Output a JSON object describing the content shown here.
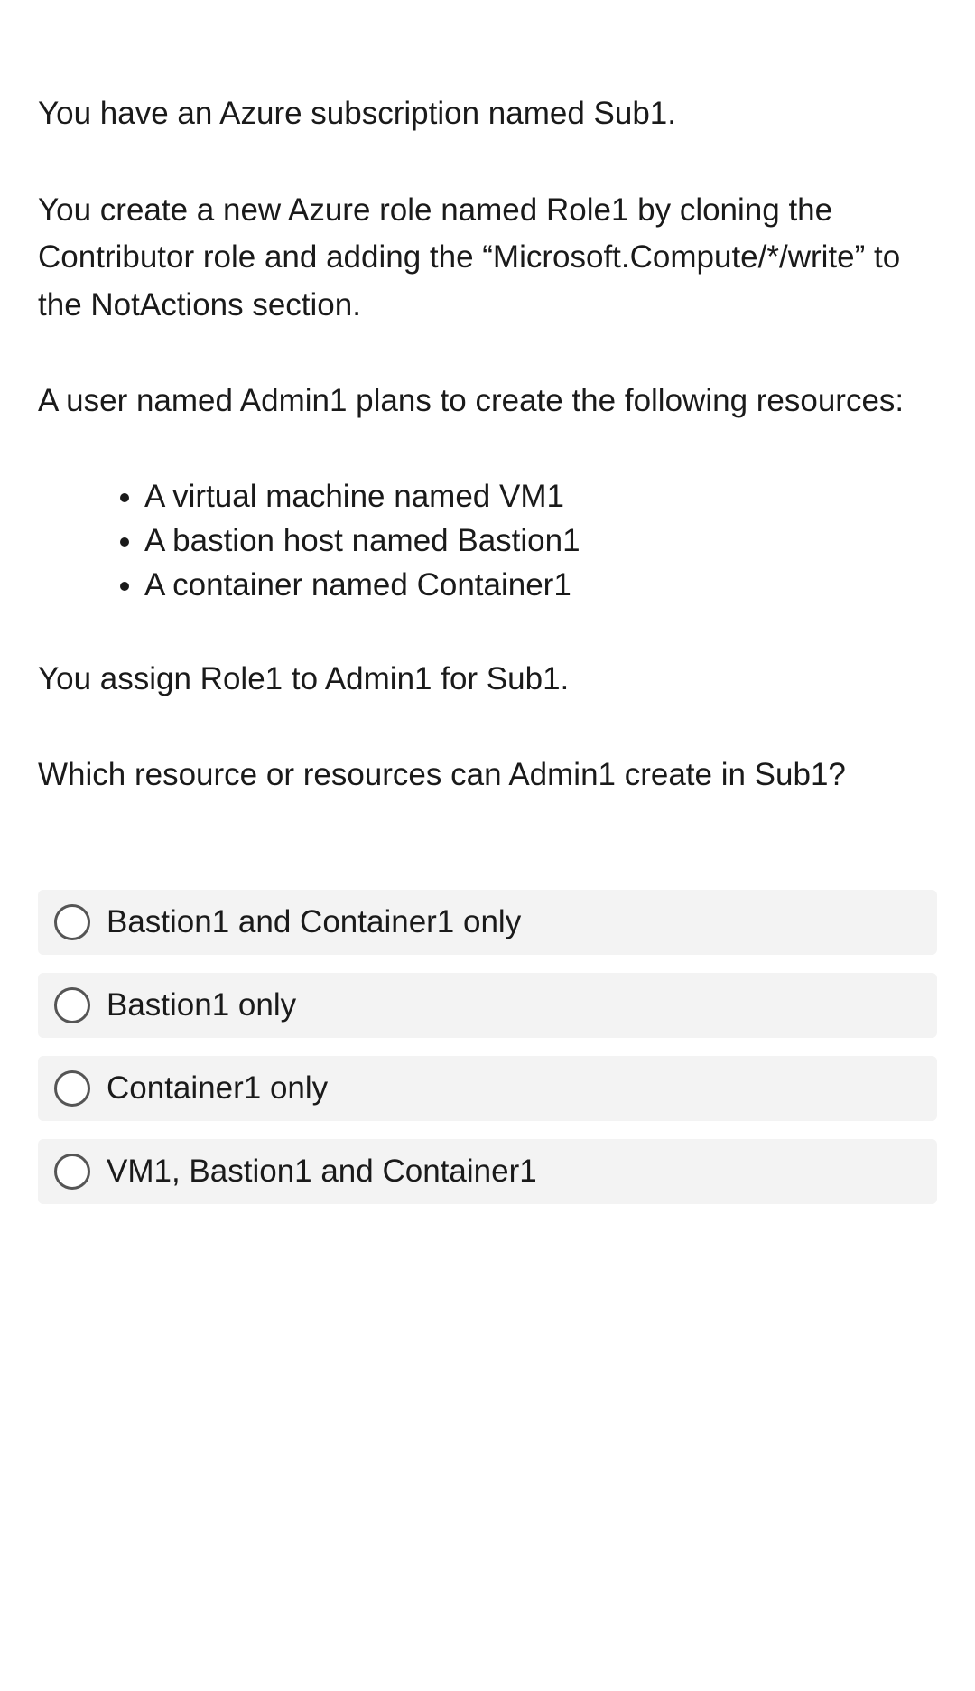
{
  "question": {
    "p1": "You have an Azure subscription named Sub1.",
    "p2": "You create a new Azure role named Role1 by cloning the Contributor role and adding the “Microsoft.Compute/*/write” to the NotActions section.",
    "p3": "A user named Admin1 plans to create the following resources:",
    "bullets": [
      "A virtual machine named VM1",
      "A bastion host named Bastion1",
      "A container named Container1"
    ],
    "p4": "You assign Role1 to Admin1 for Sub1.",
    "p5": "Which resource or resources can Admin1 create in Sub1?"
  },
  "options": [
    "Bastion1 and Container1 only",
    "Bastion1 only",
    "Container1 only",
    "VM1, Bastion1 and Container1"
  ]
}
